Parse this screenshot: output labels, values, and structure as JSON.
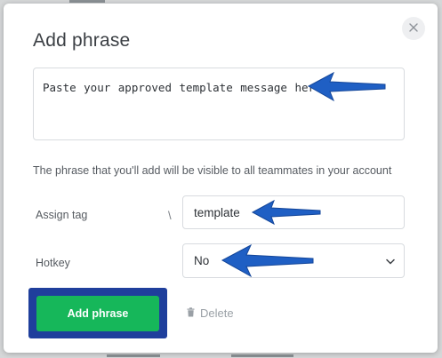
{
  "dialog": {
    "title": "Add phrase",
    "close_icon": "close-icon",
    "phrase_text": "Paste your approved template message here",
    "helper_text": "The phrase that you'll add will be visible to all teammates in your account"
  },
  "tag": {
    "label": "Assign tag",
    "separator": "\\",
    "value": "template"
  },
  "hotkey": {
    "label": "Hotkey",
    "value": "No"
  },
  "actions": {
    "add_label": "Add phrase",
    "delete_label": "Delete"
  },
  "colors": {
    "accent_green": "#16b75a",
    "highlight_blue": "#1f3f9c",
    "arrow_blue": "#1f5fc4"
  }
}
